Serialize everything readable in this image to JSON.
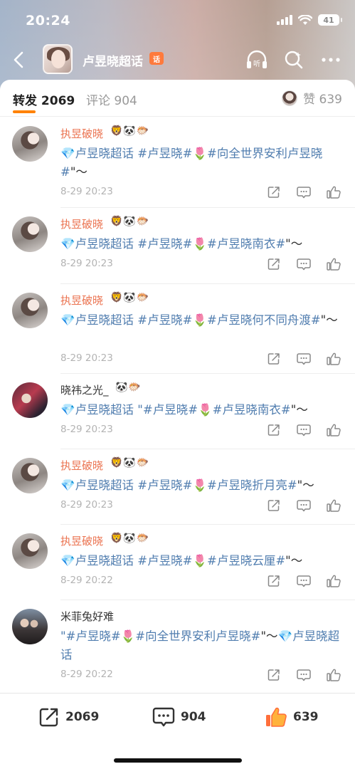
{
  "status_bar": {
    "time": "20:24",
    "battery": "41"
  },
  "nav": {
    "title": "卢昱晓超话",
    "badge": "话"
  },
  "tabs": {
    "repost": "转发 2069",
    "comment": "评论 904",
    "like": "赞 639"
  },
  "items": [
    {
      "name": "执昱破晓",
      "name_style": "orange",
      "badges": "🦁🐼🐡",
      "segments": [
        {
          "t": "💎卢昱晓超话 #卢昱晓#",
          "link": true
        },
        {
          "t": "🌷",
          "link": false
        },
        {
          "t": "#向全世界安利卢昱晓#",
          "link": true
        },
        {
          "t": "\"～",
          "link": false
        }
      ],
      "time": "8-29 20:23"
    },
    {
      "name": "执昱破晓",
      "name_style": "orange",
      "badges": "🦁🐼🐡",
      "segments": [
        {
          "t": "💎卢昱晓超话 #卢昱晓#",
          "link": true
        },
        {
          "t": "🌷",
          "link": false
        },
        {
          "t": "#卢昱晓南衣#",
          "link": true
        },
        {
          "t": "\"～",
          "link": false
        }
      ],
      "time": "8-29 20:23"
    },
    {
      "name": "执昱破晓",
      "name_style": "orange",
      "badges": "🦁🐼🐡",
      "segments": [
        {
          "t": "💎卢昱晓超话 #卢昱晓#",
          "link": true
        },
        {
          "t": "🌷",
          "link": false
        },
        {
          "t": "#卢昱晓何不同舟渡#",
          "link": true
        },
        {
          "t": "\"～",
          "link": false
        }
      ],
      "time": "8-29 20:23"
    },
    {
      "name": "晓祎之光_",
      "name_style": "plain",
      "badges": "🐼🐡",
      "segments": [
        {
          "t": "💎卢昱晓超话 \"#卢昱晓#",
          "link": true
        },
        {
          "t": "🌷",
          "link": false
        },
        {
          "t": "#卢昱晓南衣#",
          "link": true
        },
        {
          "t": "\"～",
          "link": false
        }
      ],
      "time": "8-29 20:23"
    },
    {
      "name": "执昱破晓",
      "name_style": "orange",
      "badges": "🦁🐼🐡",
      "segments": [
        {
          "t": "💎卢昱晓超话 #卢昱晓#",
          "link": true
        },
        {
          "t": "🌷",
          "link": false
        },
        {
          "t": "#卢昱晓折月亮#",
          "link": true
        },
        {
          "t": "\"～",
          "link": false
        }
      ],
      "time": "8-29 20:23"
    },
    {
      "name": "执昱破晓",
      "name_style": "orange",
      "badges": "🦁🐼🐡",
      "segments": [
        {
          "t": "💎卢昱晓超话 #卢昱晓#",
          "link": true
        },
        {
          "t": "🌷",
          "link": false
        },
        {
          "t": "#卢昱晓云厘#",
          "link": true
        },
        {
          "t": "\"～",
          "link": false
        }
      ],
      "time": "8-29 20:22"
    },
    {
      "name": "米菲兔好难",
      "name_style": "plain",
      "badges": "",
      "segments": [
        {
          "t": "\"#卢昱晓#",
          "link": true
        },
        {
          "t": "🌷",
          "link": false
        },
        {
          "t": "#向全世界安利卢昱晓#",
          "link": true
        },
        {
          "t": "\"～",
          "link": false
        },
        {
          "t": "💎卢昱晓超话",
          "link": true
        }
      ],
      "time": "8-29 20:22"
    }
  ],
  "bottom_bar": {
    "repost_count": "2069",
    "comment_count": "904",
    "like_count": "639"
  },
  "colors": {
    "accent": "#ff8200",
    "link": "#507daf",
    "name_orange": "#eb7350"
  }
}
